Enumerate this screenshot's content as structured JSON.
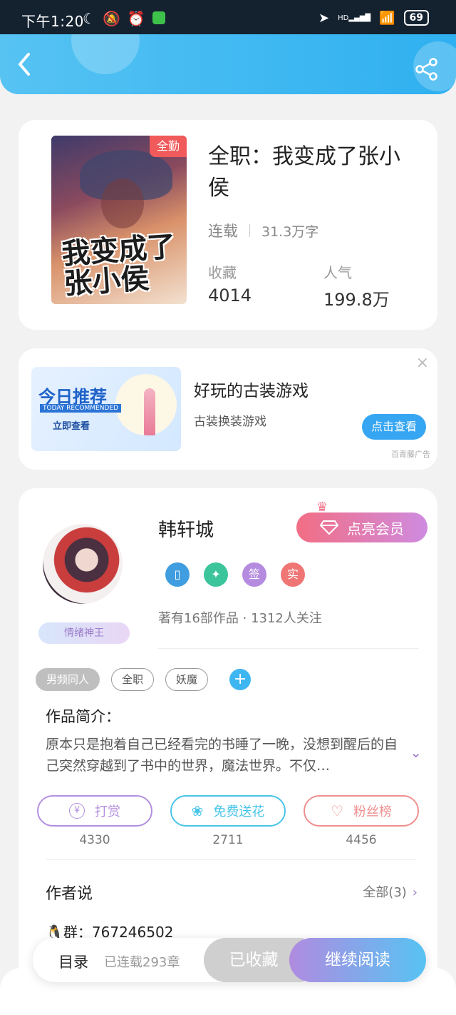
{
  "status_bar": {
    "time": "下午1:20",
    "battery": "69",
    "network": "HD"
  },
  "book": {
    "cover_badge": "全勤",
    "cover_text": "我变成了张小侯",
    "title": "全职：我变成了张小侯",
    "status": "连载",
    "word_count": "31.3万字",
    "collect_label": "收藏",
    "collect_value": "4014",
    "popularity_label": "人气",
    "popularity_value": "199.8万"
  },
  "ad": {
    "image_title": "今日推荐",
    "image_subtitle": "TODAY RECOMMENDED",
    "image_cta": "立即查看",
    "title": "好玩的古装游戏",
    "desc": "古装换装游戏",
    "button": "点击查看",
    "source": "百青藤广告",
    "close": "×"
  },
  "author": {
    "name": "韩轩城",
    "vip_button": "点亮会员",
    "avatar_badge": "情绪神王",
    "badges": [
      "签",
      "实"
    ],
    "meta": "著有16部作品 · 1312人关注"
  },
  "tags": [
    "男频同人",
    "全职",
    "妖魔"
  ],
  "intro": {
    "label": "作品简介：",
    "text": "原本只是抱着自己已经看完的书睡了一晚，没想到醒后的自己突然穿越到了书中的世界，魔法世界。不仅…"
  },
  "actions": [
    {
      "label": "打赏",
      "count": "4330",
      "color": "#b38fe0",
      "icon": "yen-icon"
    },
    {
      "label": "免费送花",
      "count": "2711",
      "color": "#47c4e8",
      "icon": "flower-icon"
    },
    {
      "label": "粉丝榜",
      "count": "4456",
      "color": "#ef8e8e",
      "icon": "fans-icon"
    }
  ],
  "author_say": {
    "label": "作者说",
    "all": "全部(3)",
    "group": "🐧群：767246502"
  },
  "bottom": {
    "toc": "目录",
    "chapters": "已连载293章",
    "collected": "已收藏",
    "continue": "继续阅读"
  },
  "colors": {
    "accent": "#36a6f2",
    "purple": "#9b7cc8",
    "header": "#4dbef2"
  }
}
